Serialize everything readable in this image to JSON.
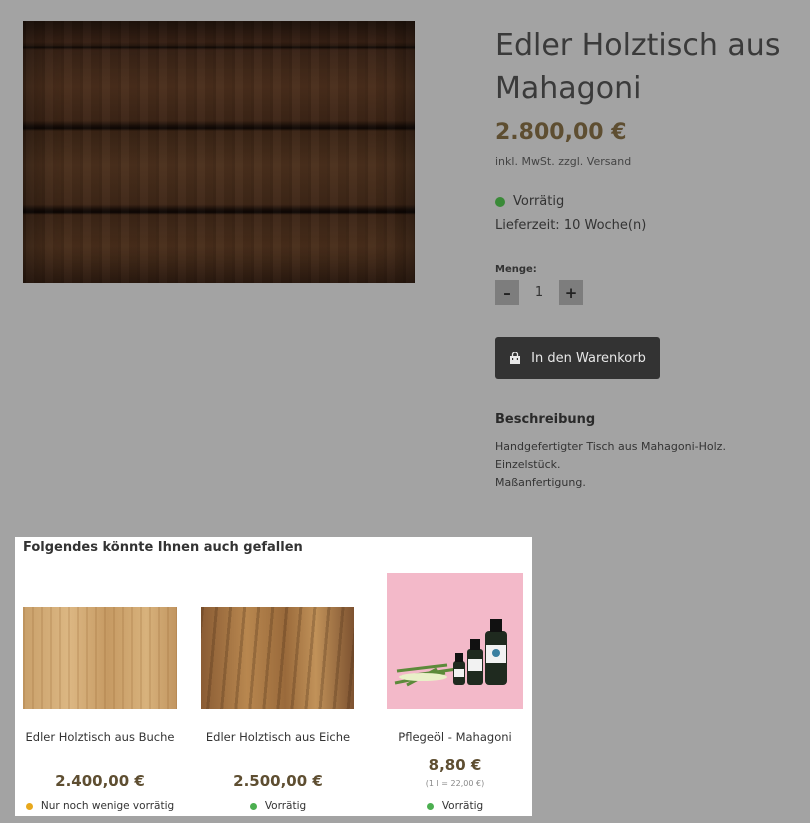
{
  "product": {
    "title": "Edler Holztisch aus Mahagoni",
    "price": "2.800,00 €",
    "tax_note": "inkl. MwSt. zzgl. Versand",
    "stock_status": "Vorrätig",
    "delivery_time": "Lieferzeit: 10 Woche(n)",
    "quantity_label": "Menge:",
    "quantity_value": "1",
    "decrement_label": "–",
    "increment_label": "+",
    "add_to_cart_label": "In den Warenkorb",
    "description_heading": "Beschreibung",
    "description_lines": [
      "Handgefertigter Tisch aus Mahagoni-Holz.",
      "Einzelstück.",
      "Maßanfertigung."
    ]
  },
  "recommendations": {
    "heading": "Folgendes könnte Ihnen auch gefallen",
    "items": [
      {
        "name": "Edler Holztisch aus Buche",
        "price": "2.400,00 €",
        "unit_price": "",
        "stock": "Nur noch wenige vorrätig",
        "stock_color": "#e8a81c"
      },
      {
        "name": "Edler Holztisch aus Eiche",
        "price": "2.500,00 €",
        "unit_price": "",
        "stock": "Vorrätig",
        "stock_color": "#4caf50"
      },
      {
        "name": "Pflegeöl - Mahagoni",
        "price": "8,80 €",
        "unit_price": "(1 l = 22,00 €)",
        "stock": "Vorrätig",
        "stock_color": "#4caf50"
      }
    ]
  },
  "colors": {
    "accent_price": "#5e4e31",
    "in_stock": "#3a8a38",
    "button_bg": "#333333"
  },
  "icons": {
    "cart": "shopping-bag-icon",
    "stock": "status-dot-icon"
  }
}
